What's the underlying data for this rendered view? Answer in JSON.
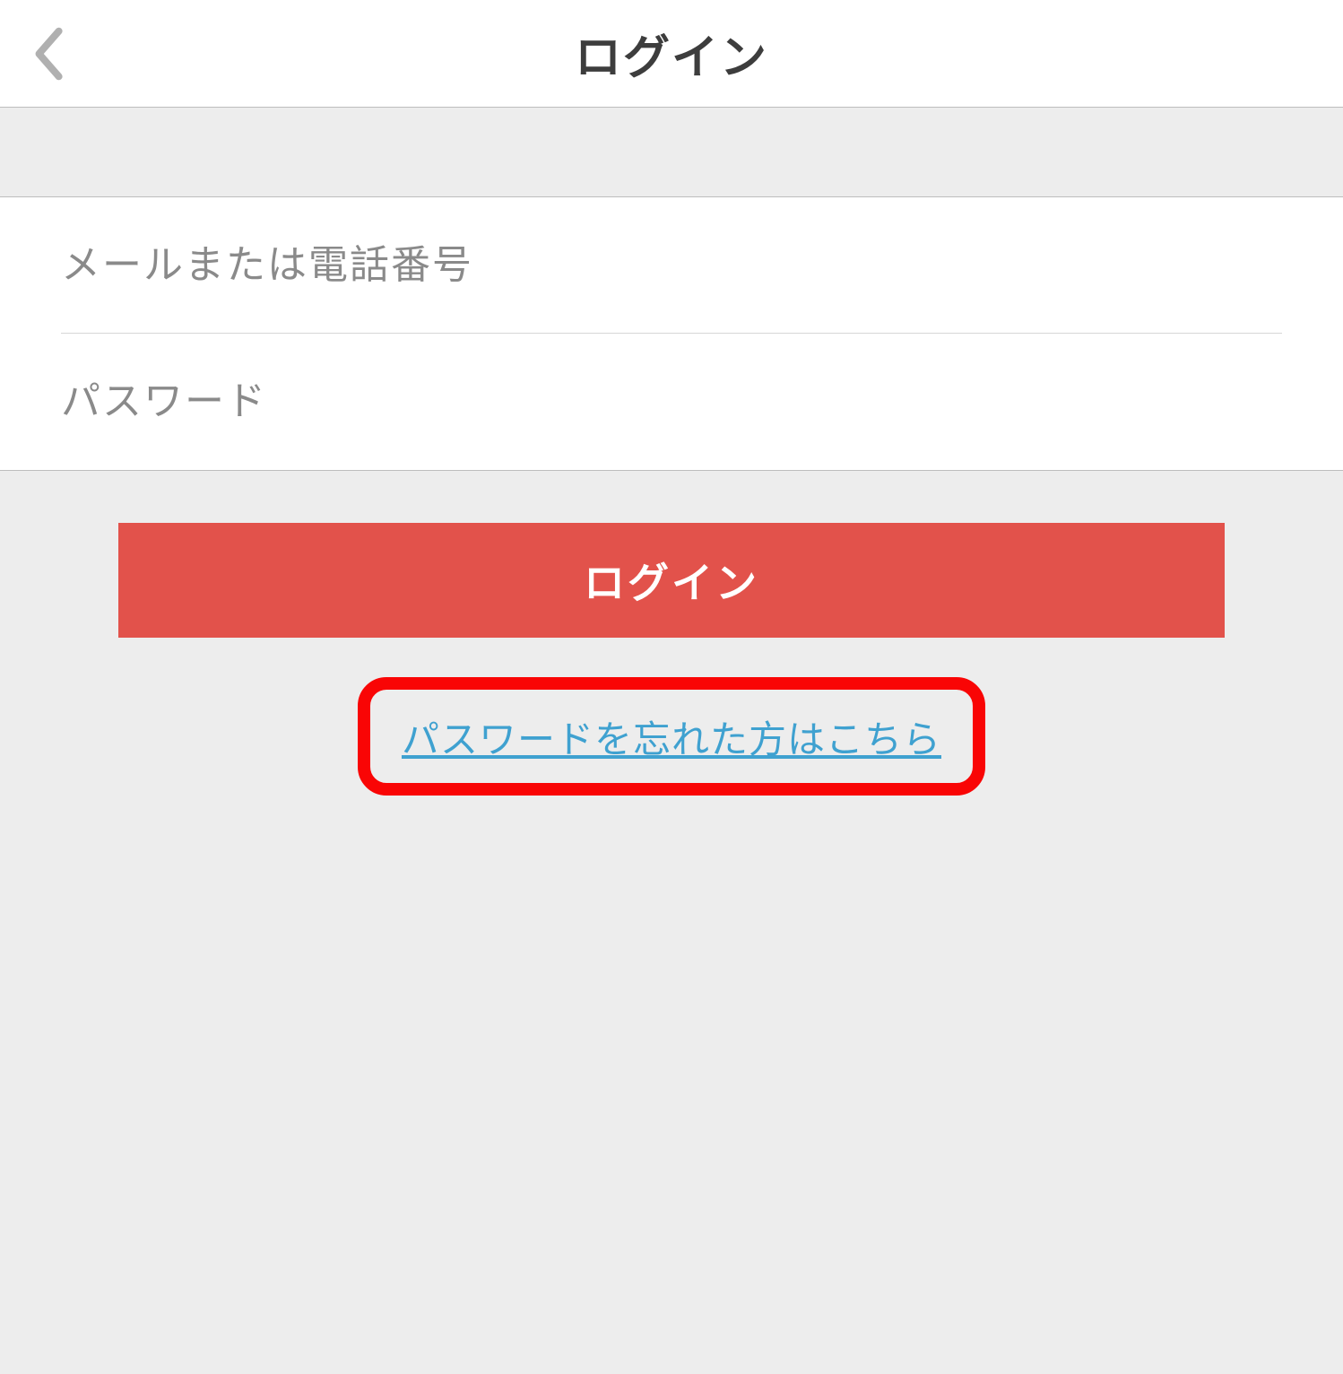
{
  "header": {
    "title": "ログイン"
  },
  "form": {
    "email_placeholder": "メールまたは電話番号",
    "password_placeholder": "パスワード"
  },
  "actions": {
    "login_label": "ログイン",
    "forgot_password_label": "パスワードを忘れた方はこちら"
  },
  "colors": {
    "primary": "#e2524b",
    "link": "#3fa1d0",
    "highlight_border": "#f90505"
  }
}
